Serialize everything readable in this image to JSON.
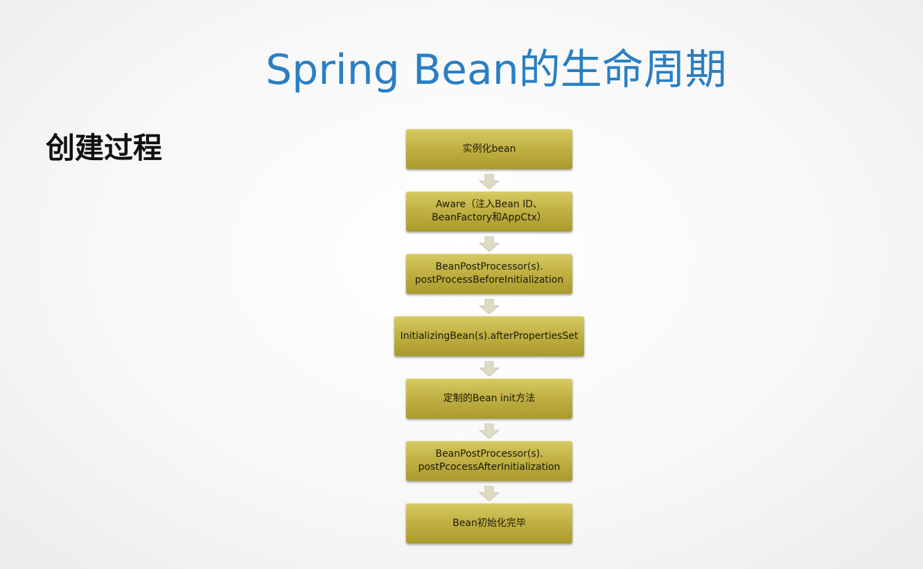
{
  "slide": {
    "title": "Spring Bean的生命周期",
    "section_label": "创建过程"
  },
  "flow": {
    "steps": [
      {
        "label": "实例化bean"
      },
      {
        "label": "Aware（注入Bean ID、\nBeanFactory和AppCtx）"
      },
      {
        "label": "BeanPostProcessor(s).\npostProcessBeforeInitialization"
      },
      {
        "label": "InitializingBean(s).afterPropertiesSet"
      },
      {
        "label": "定制的Bean init方法"
      },
      {
        "label": "BeanPostProcessor(s).\npostPcocessAfterInitialization"
      },
      {
        "label": "Bean初始化完毕"
      }
    ],
    "colors": {
      "box_top": "#d6ca63",
      "box_bottom": "#a99a2c",
      "arrow": "#dcdcc4",
      "title": "#2a7fc4"
    }
  }
}
